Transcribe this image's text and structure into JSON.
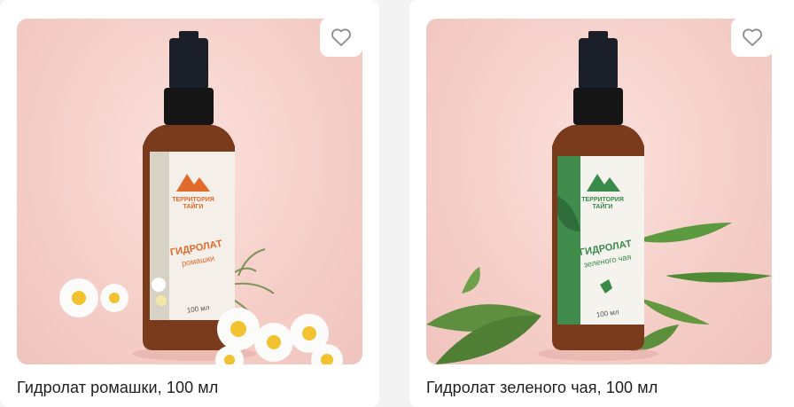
{
  "products": [
    {
      "title": "Гидролат ромашки, 100 мл",
      "label_brand": "ТЕРРИТОРИЯ ТАЙГИ",
      "label_name": "ГИДРОЛАТ",
      "label_sub": "ромашки",
      "label_volume": "100 мл",
      "favorite_icon": "heart-outline-icon"
    },
    {
      "title": "Гидролат зеленого чая, 100 мл",
      "label_brand": "ТЕРРИТОРИЯ ТАЙГИ",
      "label_name": "ГИДРОЛАТ",
      "label_sub": "зеленого чая",
      "label_volume": "100 мл",
      "favorite_icon": "heart-outline-icon"
    }
  ],
  "colors": {
    "background_pink": "#f6cfc9",
    "bottle_amber": "#7a3a1c",
    "brand_orange": "#e06a2a",
    "tea_green": "#3a8a4a"
  }
}
